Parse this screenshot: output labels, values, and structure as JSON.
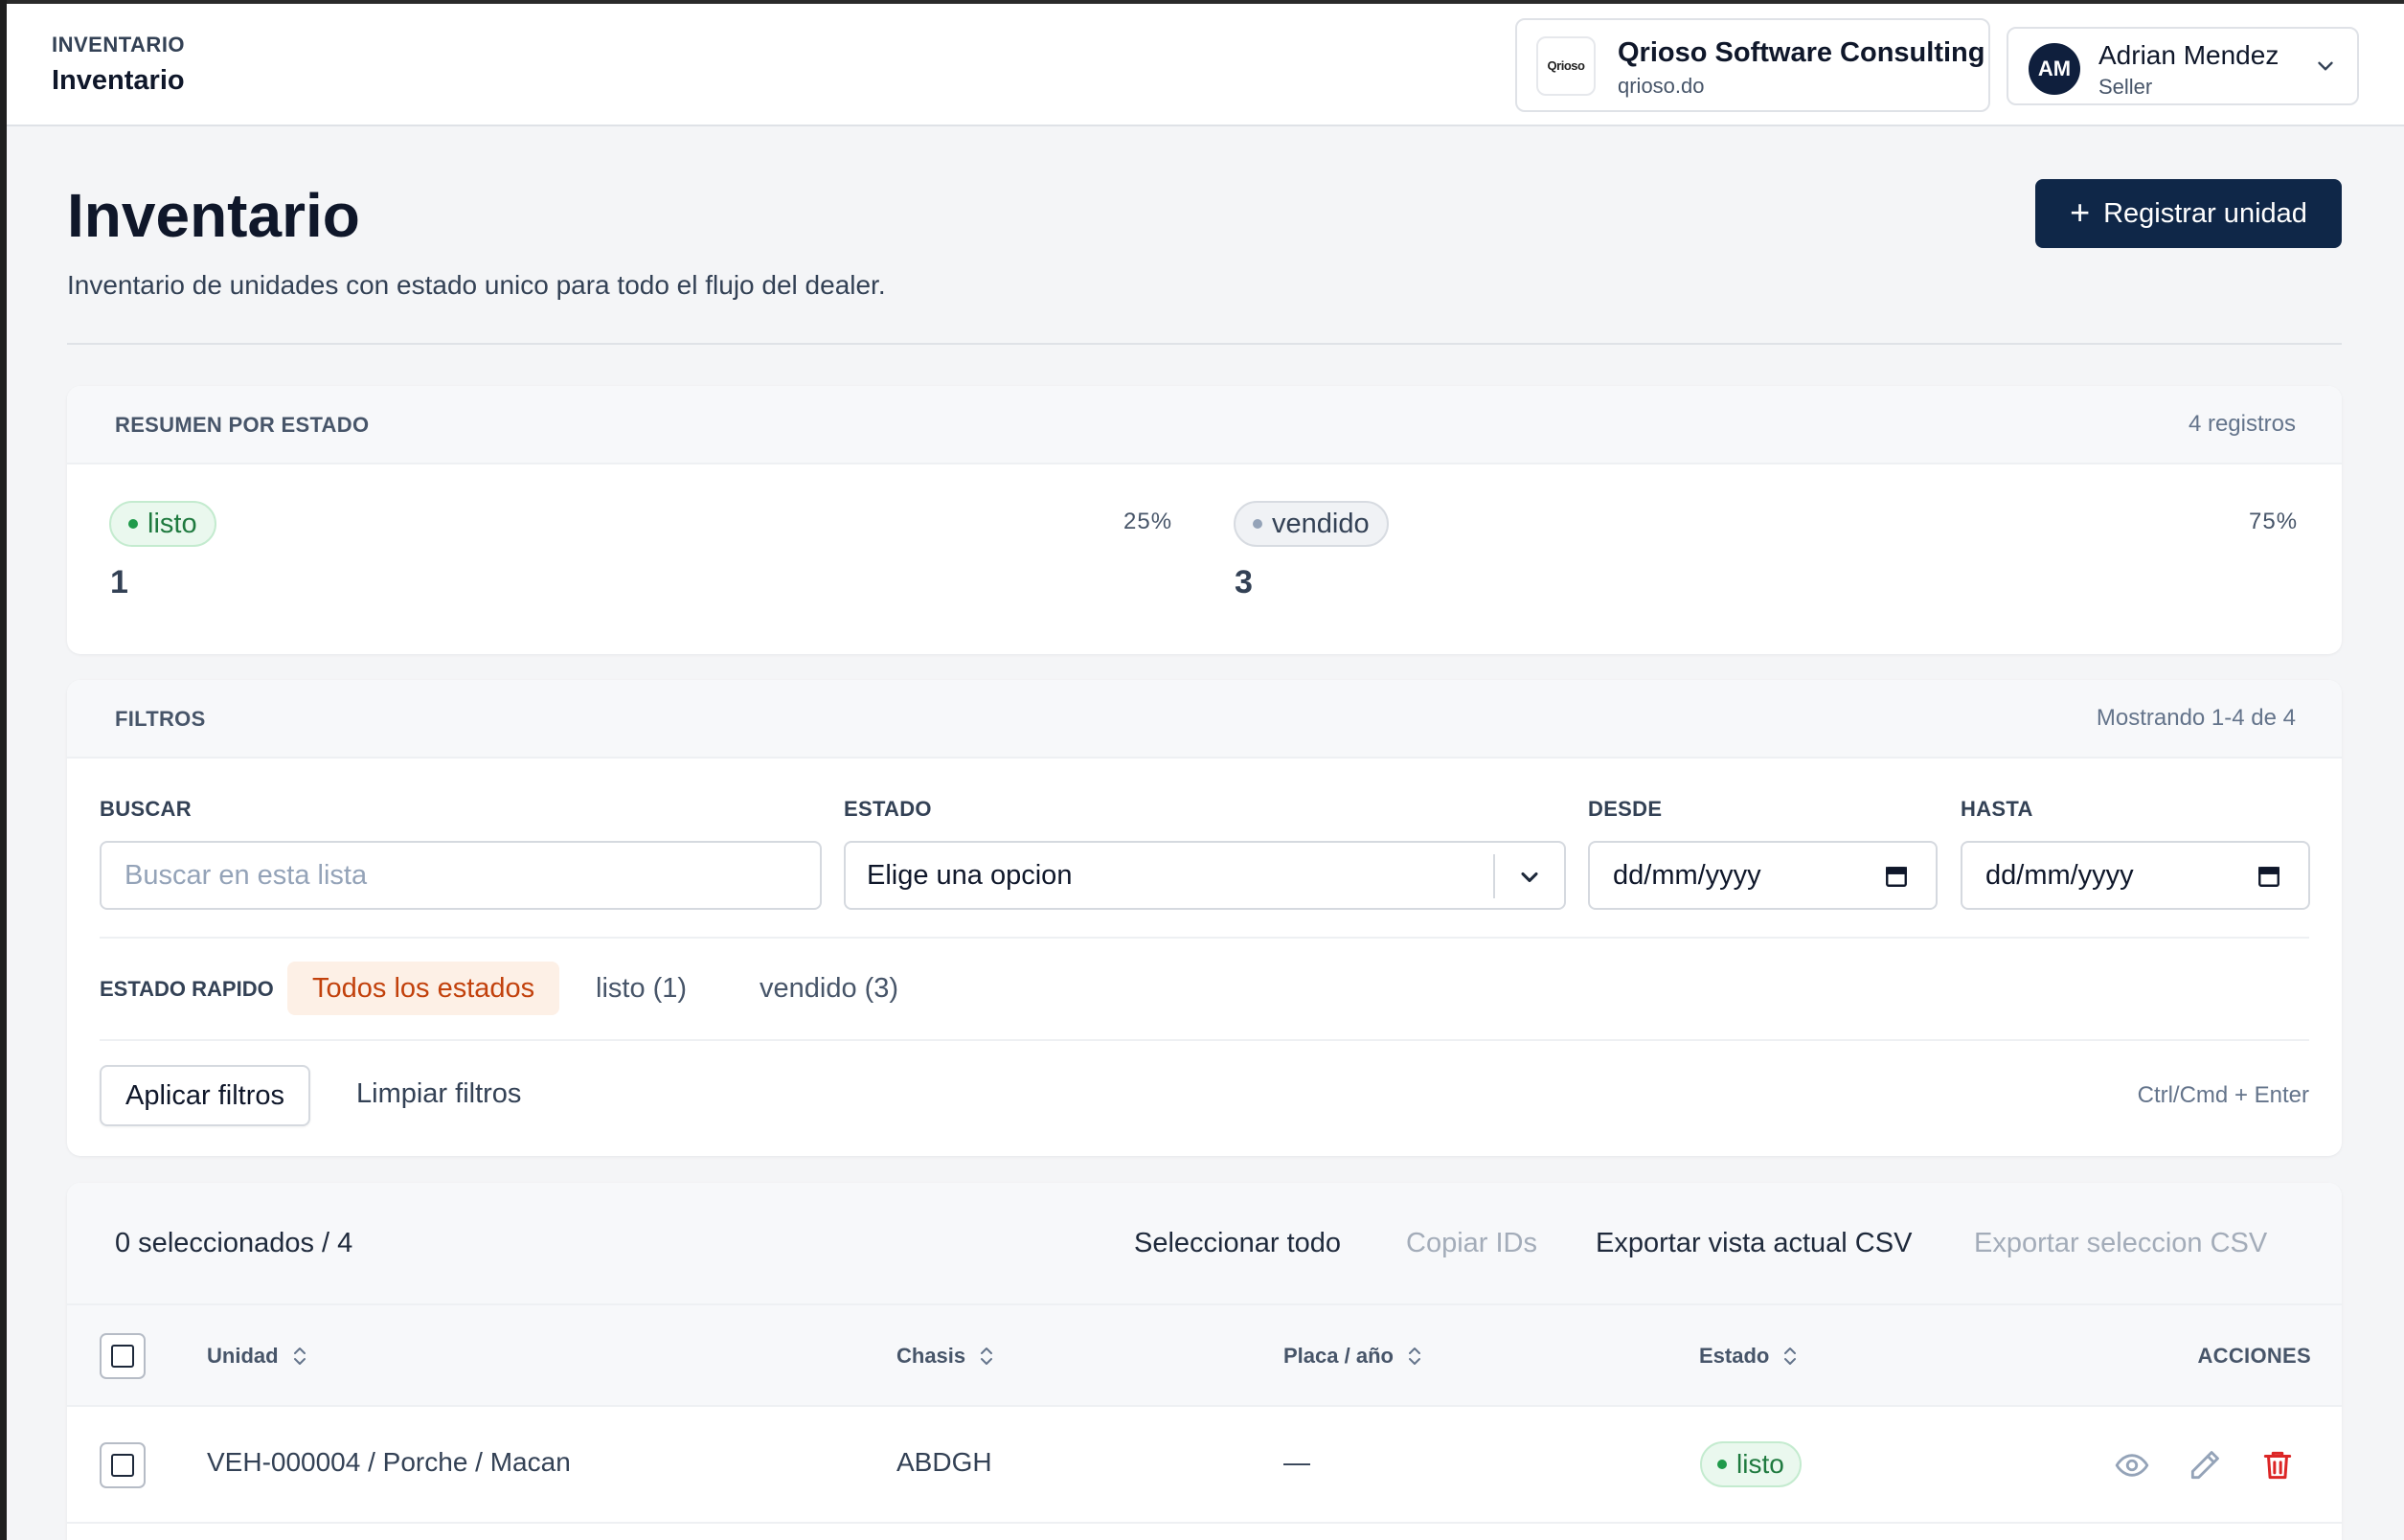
{
  "header": {
    "breadcrumb_section": "INVENTARIO",
    "breadcrumb_page": "Inventario",
    "company": {
      "logo_text": "Qrioso",
      "name": "Qrioso Software Consulting",
      "domain": "qrioso.do"
    },
    "user": {
      "initials": "AM",
      "name": "Adrian Mendez",
      "role": "Seller"
    }
  },
  "page": {
    "title": "Inventario",
    "subtitle": "Inventario de unidades con estado unico para todo el flujo del dealer.",
    "primary_action": "Registrar unidad"
  },
  "summary": {
    "label": "RESUMEN POR ESTADO",
    "meta": "4 registros",
    "items": [
      {
        "status": "listo",
        "count": "1",
        "percent": "25%"
      },
      {
        "status": "vendido",
        "count": "3",
        "percent": "75%"
      }
    ]
  },
  "filters": {
    "label": "FILTROS",
    "meta": "Mostrando 1-4 de 4",
    "search_label": "BUSCAR",
    "search_placeholder": "Buscar en esta lista",
    "status_label": "ESTADO",
    "status_value": "Elige una opcion",
    "from_label": "DESDE",
    "from_value": "dd/mm/yyyy",
    "to_label": "HASTA",
    "to_value": "dd/mm/yyyy",
    "quick_label": "ESTADO RAPIDO",
    "quick_chips": [
      "Todos los estados",
      "listo (1)",
      "vendido (3)"
    ],
    "apply": "Aplicar filtros",
    "clear": "Limpiar filtros",
    "shortcut": "Ctrl/Cmd + Enter"
  },
  "table": {
    "selection": "0 seleccionados / 4",
    "actions": [
      "Seleccionar todo",
      "Copiar IDs",
      "Exportar vista actual CSV",
      "Exportar seleccion CSV"
    ],
    "columns": [
      "Unidad",
      "Chasis",
      "Placa / año",
      "Estado",
      "ACCIONES"
    ],
    "rows": [
      {
        "unit": "VEH-000004 / Porche / Macan",
        "chassis": "ABDGH",
        "plate_year": "—",
        "status": "listo"
      }
    ]
  },
  "colors": {
    "primary": "#0f2748",
    "status_listo": "#1f7a3f",
    "status_vendido": "#334155",
    "chip_active": "#c2410c",
    "delete": "#dc2626"
  },
  "icons": [
    "chevron-down-icon",
    "plus-icon",
    "calendar-icon",
    "sort-icon",
    "eye-icon",
    "pencil-icon",
    "trash-icon"
  ]
}
